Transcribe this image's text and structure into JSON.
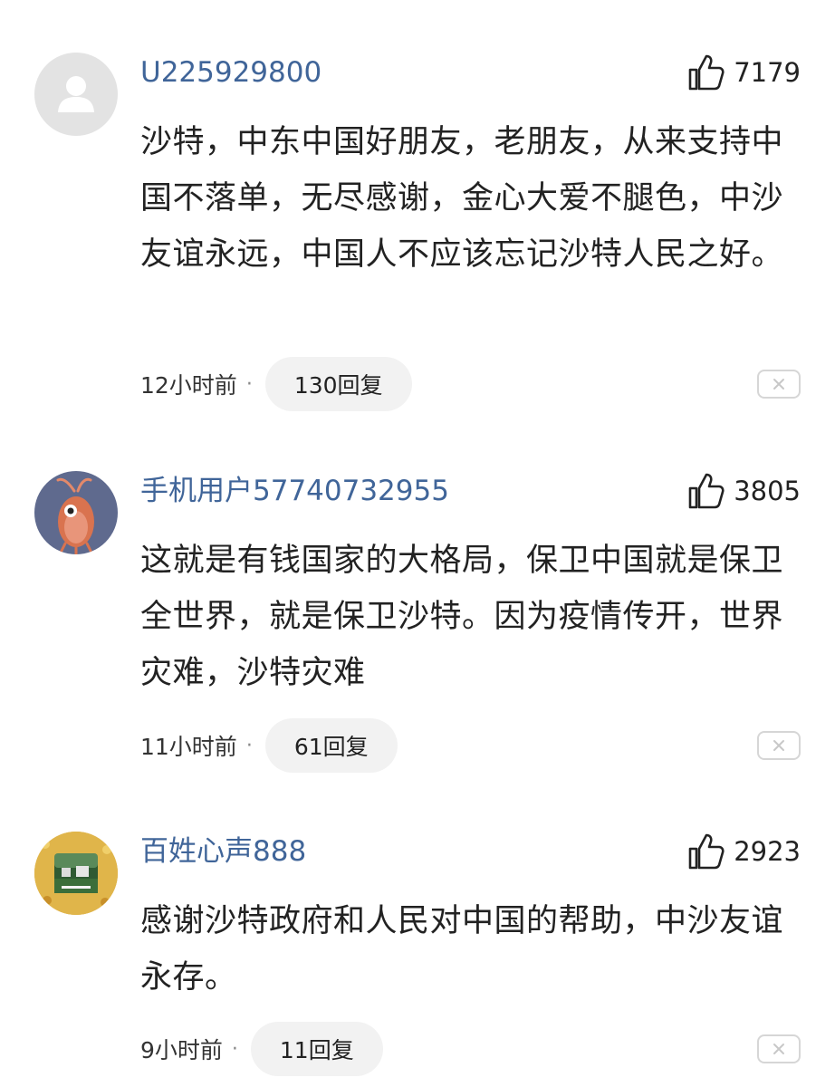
{
  "comments": [
    {
      "username": "U225929800",
      "likes": "7179",
      "content": "沙特，中东中国好朋友，老朋友，从来支持中国不落单，无尽感谢，金心大爱不腿色，中沙友谊永远，中国人不应该忘记沙特人民之好。",
      "time": "12小时前",
      "replies": "130回复",
      "avatar": "default-person-avatar"
    },
    {
      "username": "手机用户57740732955",
      "likes": "3805",
      "content": "这就是有钱国家的大格局，保卫中国就是保卫全世界，就是保卫沙特。因为疫情传开，世界灾难，沙特灾难",
      "time": "11小时前",
      "replies": "61回复",
      "avatar": "shrimp-avatar"
    },
    {
      "username": "百姓心声888",
      "likes": "2923",
      "content": "感谢沙特政府和人民对中国的帮助，中沙友谊永存。",
      "time": "9小时前",
      "replies": "11回复",
      "avatar": "landscape-photo-avatar"
    }
  ],
  "separator": "·",
  "icons": {
    "like": "thumbs-up-icon",
    "close": "close-icon"
  },
  "colors": {
    "username": "#406599",
    "text": "#222222",
    "reply_bg": "#f2f2f2"
  }
}
